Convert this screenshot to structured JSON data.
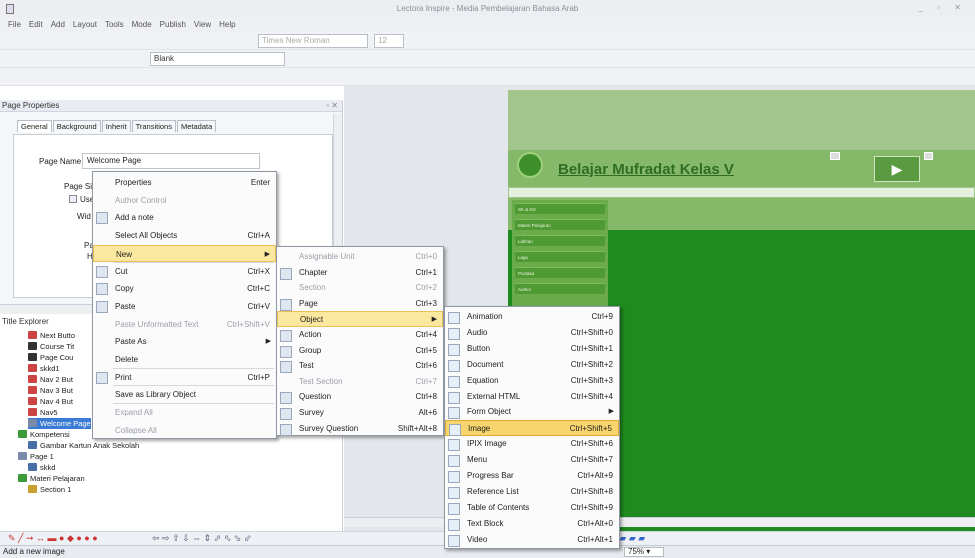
{
  "app": {
    "title": "Lectora Inspire - Media Pembelajaran Bahasa Arab"
  },
  "menubar": [
    "File",
    "Edit",
    "Add",
    "Layout",
    "Tools",
    "Mode",
    "Publish",
    "View",
    "Help"
  ],
  "toolbar": {
    "font_name": "Times New Roman",
    "font_size": "12",
    "layout_label": "Blank"
  },
  "page_properties": {
    "header": "Page Properties",
    "tabs": [
      "General",
      "Background",
      "Inherit",
      "Transitions",
      "Metadata"
    ],
    "page_name_label": "Page Name:",
    "page_name_value": "Welcome Page",
    "page_size_label": "Page Si",
    "use_label": "Use",
    "width_label": "Wid",
    "pa_label": "Pa",
    "h_label": "H"
  },
  "title_explorer": {
    "header": "Title Explorer",
    "items": [
      {
        "label": "Next Butto",
        "icon": "button-icon"
      },
      {
        "label": "Course Tit",
        "icon": "text-icon"
      },
      {
        "label": "Page Cou",
        "icon": "text-icon"
      },
      {
        "label": "skkd1",
        "icon": "button-icon"
      },
      {
        "label": "Nav 2 But",
        "icon": "button-icon"
      },
      {
        "label": "Nav 3 But",
        "icon": "button-icon"
      },
      {
        "label": "Nav 4 But",
        "icon": "button-icon"
      },
      {
        "label": "Nav5",
        "icon": "button-icon"
      },
      {
        "label": "Welcome Page",
        "icon": "page-icon"
      },
      {
        "label": "Kompetensi",
        "icon": "chapter-icon"
      },
      {
        "label": "Gambar Kartun Anak Sekolah",
        "icon": "image-icon"
      },
      {
        "label": "Page 1",
        "icon": "page-icon"
      },
      {
        "label": "skkd",
        "icon": "image-icon"
      },
      {
        "label": "Materi Pelajaran",
        "icon": "chapter-icon"
      },
      {
        "label": "Section 1",
        "icon": "section-icon"
      }
    ]
  },
  "context_menu": [
    {
      "label": "Properties",
      "key": "Enter",
      "icon": ""
    },
    {
      "label": "Author Control",
      "key": "",
      "icon": "",
      "disabled": true
    },
    {
      "label": "Add a note",
      "key": "",
      "icon": "note-icon"
    },
    {
      "label": "Select All Objects",
      "key": "Ctrl+A",
      "icon": ""
    },
    {
      "label": "New",
      "key": "",
      "icon": "",
      "submenu": true
    },
    {
      "label": "Cut",
      "key": "Ctrl+X",
      "icon": "cut-icon"
    },
    {
      "label": "Copy",
      "key": "Ctrl+C",
      "icon": "copy-icon"
    },
    {
      "label": "Paste",
      "key": "Ctrl+V",
      "icon": "paste-icon"
    },
    {
      "label": "Paste Unformatted Text",
      "key": "Ctrl+Shift+V",
      "icon": "",
      "disabled": true
    },
    {
      "label": "Paste As",
      "key": "",
      "icon": "",
      "submenu": true
    },
    {
      "label": "Delete",
      "key": "",
      "icon": ""
    },
    {
      "label": "Print",
      "key": "Ctrl+P",
      "icon": "print-icon"
    },
    {
      "label": "Save as Library Object",
      "key": "",
      "icon": ""
    },
    {
      "label": "Expand All",
      "key": "",
      "icon": "",
      "disabled": true
    },
    {
      "label": "Collapse All",
      "key": "",
      "icon": "",
      "disabled": true
    }
  ],
  "new_submenu": [
    {
      "label": "Assignable Unit",
      "key": "Ctrl+0",
      "disabled": true
    },
    {
      "label": "Chapter",
      "key": "Ctrl+1",
      "icon": "chapter-icon"
    },
    {
      "label": "Section",
      "key": "Ctrl+2",
      "disabled": true
    },
    {
      "label": "Page",
      "key": "Ctrl+3",
      "icon": "page-icon"
    },
    {
      "label": "Object",
      "key": "",
      "submenu": true
    },
    {
      "label": "Action",
      "key": "Ctrl+4",
      "icon": "action-icon"
    },
    {
      "label": "Group",
      "key": "Ctrl+5",
      "icon": "group-icon"
    },
    {
      "label": "Test",
      "key": "Ctrl+6",
      "icon": "test-icon"
    },
    {
      "label": "Test Section",
      "key": "Ctrl+7",
      "disabled": true
    },
    {
      "label": "Question",
      "key": "Ctrl+8",
      "icon": "question-icon"
    },
    {
      "label": "Survey",
      "key": "Alt+6",
      "icon": "survey-icon"
    },
    {
      "label": "Survey Question",
      "key": "Shift+Alt+8",
      "icon": "survey-question-icon"
    }
  ],
  "object_submenu": [
    {
      "label": "Animation",
      "key": "Ctrl+9"
    },
    {
      "label": "Audio",
      "key": "Ctrl+Shift+0"
    },
    {
      "label": "Button",
      "key": "Ctrl+Shift+1"
    },
    {
      "label": "Document",
      "key": "Ctrl+Shift+2"
    },
    {
      "label": "Equation",
      "key": "Ctrl+Shift+3"
    },
    {
      "label": "External HTML",
      "key": "Ctrl+Shift+4"
    },
    {
      "label": "Form Object",
      "key": "",
      "submenu": true
    },
    {
      "label": "Image",
      "key": "Ctrl+Shift+5"
    },
    {
      "label": "IPIX Image",
      "key": "Ctrl+Shift+6"
    },
    {
      "label": "Menu",
      "key": "Ctrl+Shift+7"
    },
    {
      "label": "Progress Bar",
      "key": "Ctrl+Alt+9"
    },
    {
      "label": "Reference List",
      "key": "Ctrl+Shift+8"
    },
    {
      "label": "Table of Contents",
      "key": "Ctrl+Shift+9"
    },
    {
      "label": "Text Block",
      "key": "Ctrl+Alt+0"
    },
    {
      "label": "Video",
      "key": "Ctrl+Alt+1"
    }
  ],
  "canvas": {
    "course_title": "Belajar Mufradat Kelas V",
    "nav_items": [
      "SK & KD",
      "Materi Pelajaran",
      "Latihan",
      "Lagu",
      "Pustaka",
      "Author"
    ],
    "accent": "#2f8f2a"
  },
  "statusbar": {
    "text": "Add a new image",
    "zoom": "75%"
  }
}
